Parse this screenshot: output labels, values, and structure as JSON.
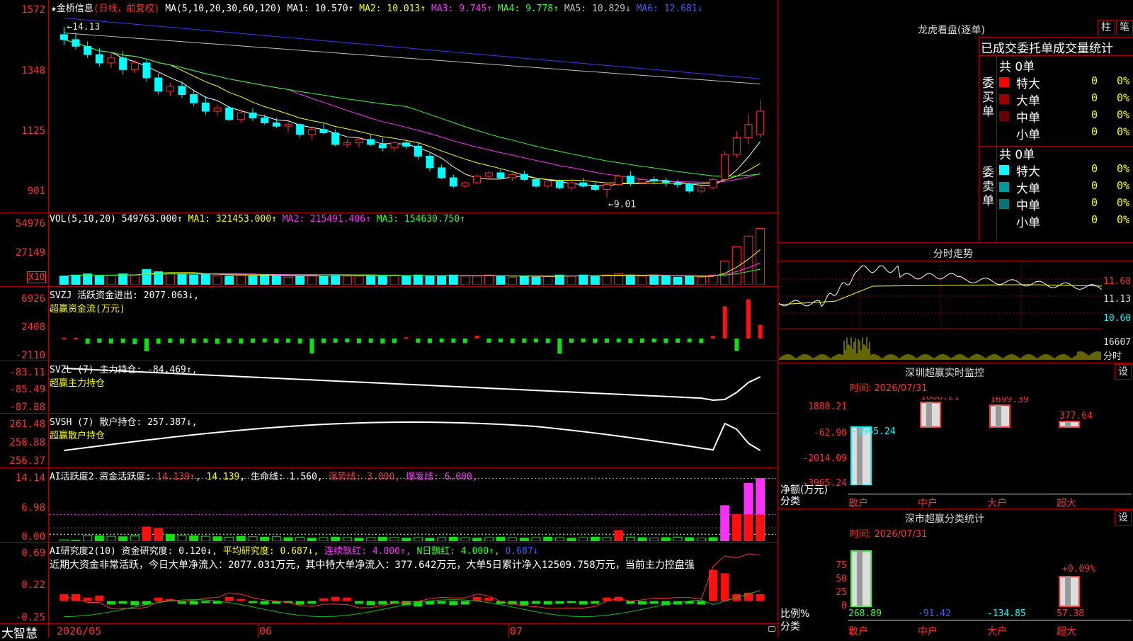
{
  "main_chart": {
    "title": "★金桥信息",
    "period": "(日线，前复权)",
    "ma_header": "MA(5,10,20,30,60,120)",
    "ma": [
      {
        "t": "MA1: 10.570↑",
        "c": "#ffffff"
      },
      {
        "t": "MA2: 10.013↑",
        "c": "#ffff00"
      },
      {
        "t": "MA3: 9.745↑",
        "c": "#ff30ff"
      },
      {
        "t": "MA4: 9.778↑",
        "c": "#30ff30"
      },
      {
        "t": "MA5: 10.829↓",
        "c": "#c0c0c0"
      },
      {
        "t": "MA6: 12.681↓",
        "c": "#4060ff"
      }
    ],
    "y_labels": [
      "1572",
      "1348",
      "1125",
      "901"
    ],
    "hi_note": "←14.13",
    "lo_note": "←9.01",
    "candles": [
      [
        13.9,
        14.13,
        13.6,
        13.75
      ],
      [
        13.75,
        13.95,
        13.45,
        13.55
      ],
      [
        13.55,
        13.7,
        13.2,
        13.3
      ],
      [
        13.3,
        13.5,
        12.95,
        13.05
      ],
      [
        13.05,
        13.35,
        12.9,
        13.2
      ],
      [
        13.2,
        13.4,
        12.7,
        12.85
      ],
      [
        12.85,
        13.15,
        12.75,
        13.05
      ],
      [
        13.05,
        13.15,
        12.5,
        12.6
      ],
      [
        12.6,
        12.75,
        12.1,
        12.2
      ],
      [
        12.2,
        12.45,
        12.05,
        12.35
      ],
      [
        12.35,
        12.5,
        12.0,
        12.1
      ],
      [
        12.1,
        12.25,
        11.75,
        11.85
      ],
      [
        11.85,
        12.05,
        11.5,
        11.6
      ],
      [
        11.6,
        11.8,
        11.45,
        11.7
      ],
      [
        11.7,
        11.75,
        11.3,
        11.35
      ],
      [
        11.35,
        11.65,
        11.25,
        11.55
      ],
      [
        11.55,
        11.7,
        11.3,
        11.4
      ],
      [
        11.4,
        11.5,
        11.2,
        11.25
      ],
      [
        11.25,
        11.4,
        11.1,
        11.15
      ],
      [
        11.15,
        11.3,
        10.95,
        11.2
      ],
      [
        11.2,
        11.25,
        10.8,
        10.9
      ],
      [
        10.9,
        11.1,
        10.75,
        11.05
      ],
      [
        11.05,
        11.25,
        10.9,
        10.95
      ],
      [
        10.95,
        11.05,
        10.55,
        10.6
      ],
      [
        10.6,
        10.75,
        10.5,
        10.65
      ],
      [
        10.65,
        10.8,
        10.5,
        10.75
      ],
      [
        10.75,
        10.9,
        10.55,
        10.6
      ],
      [
        10.6,
        10.8,
        10.4,
        10.5
      ],
      [
        10.5,
        10.7,
        10.4,
        10.65
      ],
      [
        10.65,
        10.75,
        10.45,
        10.55
      ],
      [
        10.55,
        10.65,
        10.15,
        10.25
      ],
      [
        10.25,
        10.35,
        9.8,
        9.9
      ],
      [
        9.9,
        10.0,
        9.55,
        9.6
      ],
      [
        9.6,
        9.7,
        9.3,
        9.35
      ],
      [
        9.35,
        9.5,
        9.3,
        9.45
      ],
      [
        9.45,
        9.7,
        9.4,
        9.65
      ],
      [
        9.65,
        9.8,
        9.55,
        9.75
      ],
      [
        9.75,
        9.85,
        9.55,
        9.6
      ],
      [
        9.6,
        9.75,
        9.5,
        9.7
      ],
      [
        9.7,
        9.8,
        9.5,
        9.55
      ],
      [
        9.55,
        9.6,
        9.3,
        9.35
      ],
      [
        9.35,
        9.55,
        9.3,
        9.5
      ],
      [
        9.5,
        9.55,
        9.25,
        9.3
      ],
      [
        9.3,
        9.5,
        9.2,
        9.45
      ],
      [
        9.45,
        9.6,
        9.3,
        9.35
      ],
      [
        9.35,
        9.45,
        9.2,
        9.25
      ],
      [
        9.25,
        9.45,
        9.01,
        9.4
      ],
      [
        9.4,
        9.7,
        9.35,
        9.65
      ],
      [
        9.65,
        9.8,
        9.35,
        9.45
      ],
      [
        9.45,
        9.6,
        9.4,
        9.55
      ],
      [
        9.55,
        9.65,
        9.4,
        9.5
      ],
      [
        9.5,
        9.6,
        9.35,
        9.45
      ],
      [
        9.45,
        9.55,
        9.3,
        9.4
      ],
      [
        9.4,
        9.45,
        9.15,
        9.2
      ],
      [
        9.2,
        9.35,
        9.15,
        9.3
      ],
      [
        9.3,
        9.6,
        9.25,
        9.55
      ],
      [
        9.55,
        10.4,
        9.5,
        10.3
      ],
      [
        10.3,
        11.0,
        10.2,
        10.8
      ],
      [
        10.8,
        11.5,
        10.6,
        11.2
      ],
      [
        10.9,
        11.95,
        10.8,
        11.6
      ]
    ],
    "yrange": [
      8.6,
      14.6
    ]
  },
  "vol": {
    "header": "VOL(5,10,20)",
    "v0": "549763.000↑",
    "v": [
      {
        "t": "MA1: 321453.000↑",
        "c": "#ffff00"
      },
      {
        "t": "MA2: 215491.406↑",
        "c": "#ff30ff"
      },
      {
        "t": "MA3: 154630.750↑",
        "c": "#30ff30"
      }
    ],
    "y_labels": [
      "54976",
      "27149"
    ],
    "unit": "X10",
    "bars": [
      8,
      9,
      10,
      8,
      9,
      10,
      9,
      14,
      12,
      11,
      10,
      9,
      10,
      9,
      8,
      9,
      8,
      9,
      8,
      7,
      8,
      9,
      8,
      9,
      8,
      8,
      9,
      8,
      9,
      8,
      9,
      8,
      8,
      9,
      8,
      8,
      9,
      8,
      7,
      8,
      7,
      8,
      9,
      8,
      9,
      8,
      9,
      10,
      9,
      8,
      9,
      8,
      7,
      8,
      7,
      9,
      22,
      35,
      45,
      52
    ]
  },
  "svzj": {
    "header": "SVZJ  活跃资金进出: 2077.063↓,",
    "sub": "超赢资金流(万元)",
    "y_labels": [
      "6926",
      "2408",
      "-2110"
    ],
    "bars": [
      0.2,
      0.2,
      -1.5,
      -1.2,
      -1.4,
      -1.3,
      -1.6,
      -3.6,
      -1.5,
      -1.2,
      -1.4,
      -1.3,
      -1.2,
      -1.5,
      -1.3,
      -1.4,
      -1.2,
      -1.1,
      -1.3,
      -1.2,
      -1.4,
      -4.2,
      -1.3,
      -1.2,
      -1.1,
      -1.3,
      -1.2,
      -1.4,
      -1.3,
      0.3,
      -1.2,
      -1.3,
      -1.1,
      -1.2,
      -1.3,
      0.8,
      -1.2,
      -1.1,
      -1.3,
      -1.2,
      -1.1,
      -1.3,
      -4.3,
      -1.2,
      -1.1,
      -1.3,
      -1.2,
      -1.1,
      -1.3,
      -1.2,
      -1.1,
      -1.3,
      -1.2,
      -1.1,
      -1.3,
      0.7,
      9.0,
      -3.5,
      11.0,
      3.8
    ]
  },
  "svzl": {
    "header": "SVZL (7) 主力持仓: -84.469↑,",
    "sub": "超赢主力持仓",
    "y_labels": [
      "-83.11",
      "-85.49",
      "-87.88"
    ]
  },
  "svsh": {
    "header": "SVSH (7) 散户持仓: 257.387↓,",
    "sub": "超赢散户持仓",
    "y_labels": [
      "261.48",
      "258.88",
      "256.37"
    ]
  },
  "ai_active": {
    "pre": "AI活跃度2 资金活跃度: ",
    "v1": "14.139↑",
    "v2": ", 14.139",
    "v3": ", 生命线: 1.560,",
    "v4": " 强势线: 3.000,",
    "v5": " 爆发线: 6.000,",
    "y_labels": [
      "14.14",
      "6.98",
      "0.00"
    ],
    "bars": [
      0.3,
      0.2,
      1.3,
      1.2,
      1.1,
      1.0,
      1.2,
      3.2,
      2.8,
      1.5,
      1.3,
      1.2,
      1.1,
      1.0,
      0.9,
      1.1,
      1.0,
      0.9,
      1.0,
      0.8,
      0.9,
      0.7,
      0.8,
      0.9,
      0.8,
      0.7,
      0.8,
      0.9,
      0.8,
      0.7,
      0.8,
      0.7,
      0.8,
      0.9,
      0.8,
      0.7,
      0.8,
      0.9,
      0.8,
      0.7,
      0.8,
      0.9,
      0.8,
      0.7,
      0.8,
      0.9,
      0.8,
      2.4,
      0.9,
      0.8,
      0.7,
      0.8,
      0.9,
      0.8,
      0.7,
      0.8,
      8.0,
      6.0,
      13.0,
      14.1
    ]
  },
  "ai_research": {
    "pre": "AI研究度2(10) 资金研究度: 0.120↓,",
    "v1": " 平均研究度: 0.687↓,",
    "v2": " 连续飘红: 4.000↑,",
    "v3": " N日飘红: 4.000↑,",
    "v4": " 0.687↓",
    "comment": "近期大资金非常活跃，今日大单净流入：2077.031万元，其中特大单净流入：377.642万元，大单5日累计净入12509.758万元，当前主力控盘强",
    "y_labels": [
      "0.69",
      "0.22",
      "-0.25"
    ],
    "bars": [
      0.1,
      0.1,
      0.05,
      0.08,
      -0.05,
      -0.04,
      -0.06,
      -0.05,
      0.05,
      0.03,
      -0.04,
      -0.05,
      -0.03,
      -0.04,
      0.06,
      0.03,
      -0.03,
      -0.05,
      -0.04,
      -0.03,
      -0.05,
      -0.04,
      0.04,
      0.06,
      0.05,
      -0.04,
      -0.06,
      -0.05,
      -0.04,
      -0.06,
      -0.08,
      -0.05,
      -0.04,
      -0.06,
      -0.05,
      0.06,
      0.05,
      -0.04,
      -0.05,
      -0.06,
      -0.04,
      -0.05,
      -0.04,
      -0.03,
      -0.05,
      -0.04,
      0.05,
      0.06,
      -0.04,
      -0.05,
      -0.04,
      -0.06,
      -0.05,
      -0.04,
      -0.05,
      0.45,
      0.4,
      0.1,
      0.12,
      0.1
    ]
  },
  "footer": {
    "brand": "大智慧",
    "dates": [
      "2026/05",
      "06",
      "07"
    ]
  },
  "right": {
    "lh_title": "龙虎看盘(逐单)",
    "btn1": "柱",
    "btn2": "笔",
    "stat_title": "已成交委托单成交量统计",
    "buy_label": "委\n买\n单",
    "sell_label": "委\n卖\n单",
    "buy_total": "共 0单",
    "sell_total": "共 0单",
    "buy_rows": [
      {
        "name": "特大",
        "v": "0",
        "p": "0%",
        "c": "#ff0000"
      },
      {
        "name": "大单",
        "v": "0",
        "p": "0%",
        "c": "#990000"
      },
      {
        "name": "中单",
        "v": "0",
        "p": "0%",
        "c": "#660000"
      },
      {
        "name": "小单",
        "v": "0",
        "p": "0%",
        "c": ""
      }
    ],
    "sell_rows": [
      {
        "name": "特大",
        "v": "0",
        "p": "0%",
        "c": "#00ffff"
      },
      {
        "name": "大单",
        "v": "0",
        "p": "0%",
        "c": "#009999"
      },
      {
        "name": "中单",
        "v": "0",
        "p": "0%",
        "c": "#007777"
      },
      {
        "name": "小单",
        "v": "0",
        "p": "0%",
        "c": ""
      }
    ],
    "ts_title": "分时走势",
    "ts_prices": [
      "11.60",
      "11.13",
      "10.60"
    ],
    "ts_vol": "16607",
    "ts_vol_unit": "分时",
    "sz_title": "深圳超赢实时监控",
    "sz_time": "时间: 2026/07/31",
    "set": "设",
    "sz_vals": [
      "1888.21",
      "-62.90",
      "-2014.09",
      "-3965.24"
    ],
    "sz_bars": [
      {
        "label": "-3965.24",
        "c": "#00ffff"
      },
      {
        "label": "1888.21",
        "c": "#ff3030"
      },
      {
        "label": "1699.39",
        "c": "#ff3030"
      },
      {
        "label": "377.64",
        "c": "#ff3030"
      }
    ],
    "sz_unit": "净额(万元)",
    "sz_cat": "分类",
    "cats": [
      "散户",
      "中户",
      "大户",
      "超大"
    ],
    "ss_title": "深市超赢分类统计",
    "ss_time": "时间: 2026/07/31",
    "ss_y": [
      "75",
      "50",
      "25",
      "0"
    ],
    "ss_note": "+0.09%",
    "ss_unit": "比例%",
    "ss_cat": "分类",
    "ss_vals": [
      {
        "t": "268.89",
        "c": "#30ff30"
      },
      {
        "t": "-91.42",
        "c": "#4060ff"
      },
      {
        "t": "-134.85",
        "c": "#00ffff"
      },
      {
        "t": "57.38",
        "c": "#ff3030"
      }
    ]
  }
}
